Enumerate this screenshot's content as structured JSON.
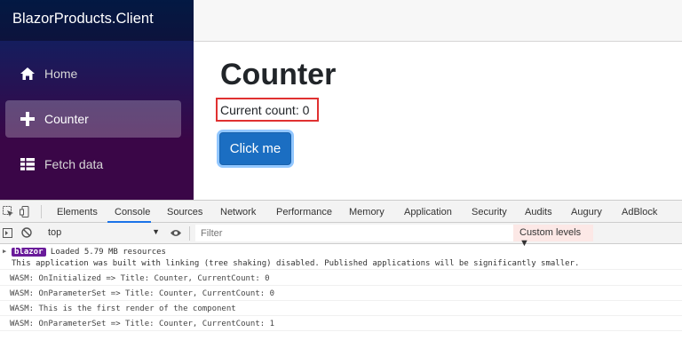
{
  "app": {
    "brand": "BlazorProducts.Client",
    "nav": [
      {
        "label": "Home",
        "icon": "home-icon"
      },
      {
        "label": "Counter",
        "icon": "plus-icon",
        "active": true
      },
      {
        "label": "Fetch data",
        "icon": "list-icon"
      }
    ],
    "page_title": "Counter",
    "count_text": "Current count: 0",
    "button_label": "Click me"
  },
  "devtools": {
    "tabs": [
      "Elements",
      "Console",
      "Sources",
      "Network",
      "Performance",
      "Memory",
      "Application",
      "Security",
      "Audits",
      "Augury",
      "AdBlock"
    ],
    "active_tab": "Console",
    "context": "top",
    "filter_placeholder": "Filter",
    "levels": "Custom levels ▼",
    "logs": [
      {
        "badge": "blazor",
        "text": " Loaded 5.79 MB resources"
      },
      {
        "text": "This application was built with linking (tree shaking) disabled. Published applications will be significantly smaller."
      },
      {
        "text": "WASM: OnInitialized => Title: Counter, CurrentCount: 0"
      },
      {
        "text": "WASM: OnParameterSet => Title: Counter, CurrentCount: 0"
      },
      {
        "text": "WASM: This is the first render of the component"
      },
      {
        "text": "WASM: OnParameterSet => Title: Counter, CurrentCount: 1"
      }
    ]
  },
  "colors": {
    "sidebar_top": "#052767",
    "sidebar_bottom": "#3a0647",
    "button": "#1b6ec2",
    "highlight_box": "#e03131",
    "badge": "#6a1b9a"
  }
}
